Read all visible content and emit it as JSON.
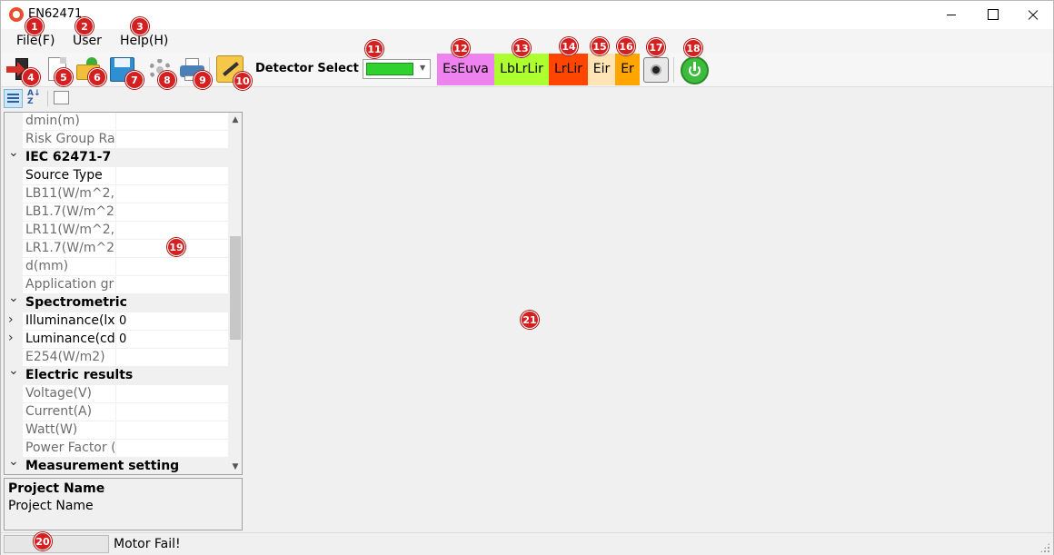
{
  "window": {
    "title": "EN62471"
  },
  "menu": {
    "file": "File(F)",
    "user": "User",
    "help": "Help(H)"
  },
  "toolbar": {
    "detector_label": "Detector Select",
    "detector_color": "#2fd12f",
    "buttons": {
      "eseuva": "EsEuva",
      "lblrlir": "LbLrLir",
      "lrlir": "LrLir",
      "eir": "Eir",
      "er": "Er"
    },
    "button_colors": {
      "eseuva": "#ee82ee",
      "lblrlir": "#adff2f",
      "lrlir": "#ff4500",
      "eir": "#ffe4b5",
      "er": "#ffa500"
    },
    "icons": [
      "exit-icon",
      "new-icon",
      "open-icon",
      "save-icon",
      "settings-icon",
      "print-icon",
      "calibrate-icon",
      "camera-icon",
      "power-icon"
    ]
  },
  "property_grid": {
    "rows": [
      {
        "type": "prop",
        "name": "dmin(m)",
        "value": "",
        "disabled": true
      },
      {
        "type": "prop",
        "name": "Risk Group Ra",
        "value": "",
        "disabled": true
      },
      {
        "type": "category",
        "name": "IEC 62471-7"
      },
      {
        "type": "prop",
        "name": "Source Type",
        "value": "",
        "disabled": false
      },
      {
        "type": "prop",
        "name": "LB11(W/m^2,",
        "value": "",
        "disabled": true
      },
      {
        "type": "prop",
        "name": "LB1.7(W/m^2",
        "value": "",
        "disabled": true
      },
      {
        "type": "prop",
        "name": "LR11(W/m^2,",
        "value": "",
        "disabled": true
      },
      {
        "type": "prop",
        "name": "LR1.7(W/m^2",
        "value": "",
        "disabled": true
      },
      {
        "type": "prop",
        "name": "d(mm)",
        "value": "",
        "disabled": true
      },
      {
        "type": "prop",
        "name": "Application gr",
        "value": "",
        "disabled": true
      },
      {
        "type": "category",
        "name": "Spectrometric"
      },
      {
        "type": "expandable",
        "name": "Illuminance(lx)",
        "value": "0",
        "disabled": false
      },
      {
        "type": "expandable",
        "name": "Luminance(cd",
        "value": "0",
        "disabled": false
      },
      {
        "type": "prop",
        "name": "E254(W/m2)",
        "value": "",
        "disabled": true
      },
      {
        "type": "category",
        "name": "Electric results"
      },
      {
        "type": "prop",
        "name": "Voltage(V)",
        "value": "",
        "disabled": true
      },
      {
        "type": "prop",
        "name": "Current(A)",
        "value": "",
        "disabled": true
      },
      {
        "type": "prop",
        "name": "Watt(W)",
        "value": "",
        "disabled": true
      },
      {
        "type": "prop",
        "name": "Power Factor (",
        "value": "",
        "disabled": true
      },
      {
        "type": "category",
        "name": "Measurement setting"
      }
    ]
  },
  "description": {
    "title": "Project Name",
    "text": "Project Name"
  },
  "status": {
    "text": "Motor Fail!"
  },
  "badges": [
    "1",
    "2",
    "3",
    "4",
    "5",
    "6",
    "7",
    "8",
    "9",
    "10",
    "11",
    "12",
    "13",
    "14",
    "15",
    "16",
    "17",
    "18",
    "19",
    "20",
    "21"
  ]
}
